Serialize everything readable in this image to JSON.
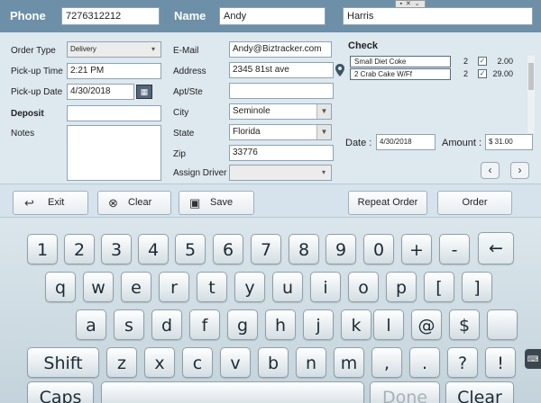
{
  "header": {
    "phone_label": "Phone",
    "phone_value": "7276312212",
    "name_label": "Name",
    "first_name": "Andy",
    "last_name": "Harris",
    "window_controls": "▪ ✕ ⌄"
  },
  "form": {
    "order_type": {
      "label": "Order Type",
      "value": "Delivery"
    },
    "pickup_time": {
      "label": "Pick-up Time",
      "value": "2:21 PM"
    },
    "pickup_date": {
      "label": "Pick-up Date",
      "value": "4/30/2018"
    },
    "deposit": {
      "label": "Deposit",
      "value": ""
    },
    "notes": {
      "label": "Notes",
      "value": ""
    },
    "email": {
      "label": "E-Mail",
      "value": "Andy@Biztracker.com"
    },
    "address": {
      "label": "Address",
      "value": "2345 81st ave"
    },
    "apt": {
      "label": "Apt/Ste",
      "value": ""
    },
    "city": {
      "label": "City",
      "value": "Seminole"
    },
    "state": {
      "label": "State",
      "value": "Florida"
    },
    "zip": {
      "label": "Zip",
      "value": "33776"
    },
    "assign_driver": {
      "label": "Assign Driver",
      "value": ""
    }
  },
  "check": {
    "title": "Check",
    "items": [
      {
        "name": "Small Diet Coke",
        "qty": "2",
        "checked": "✓",
        "price": "2.00"
      },
      {
        "name": "2 Crab Cake W/Ff",
        "qty": "2",
        "checked": "✓",
        "price": "29.00"
      }
    ],
    "date_label": "Date :",
    "date_value": "4/30/2018",
    "amount_label": "Amount :",
    "amount_value": "$ 31.00",
    "prev": "‹",
    "next": "›"
  },
  "actions": {
    "exit": "Exit",
    "clear": "Clear",
    "save": "Save",
    "repeat_order": "Repeat Order",
    "order": "Order"
  },
  "keyboard": {
    "row1": [
      "1",
      "2",
      "3",
      "4",
      "5",
      "6",
      "7",
      "8",
      "9",
      "0",
      "+",
      "-",
      "←"
    ],
    "row2": [
      "q",
      "w",
      "e",
      "r",
      "t",
      "y",
      "u",
      "i",
      "o",
      "p",
      "[",
      "]"
    ],
    "row3": [
      "a",
      "s",
      "d",
      "f",
      "g",
      "h",
      "j",
      "k",
      "l",
      "@",
      "$"
    ],
    "row4": [
      "Shift",
      "z",
      "x",
      "c",
      "v",
      "b",
      "n",
      "m",
      ",",
      ".",
      "?",
      "!"
    ],
    "row5": [
      "Caps",
      "",
      "Done",
      "Clear"
    ]
  },
  "colors": {
    "header_bg": "#6d8fa8",
    "form_bg": "#dde8ef",
    "keyboard_bg": "#c4d3db"
  }
}
